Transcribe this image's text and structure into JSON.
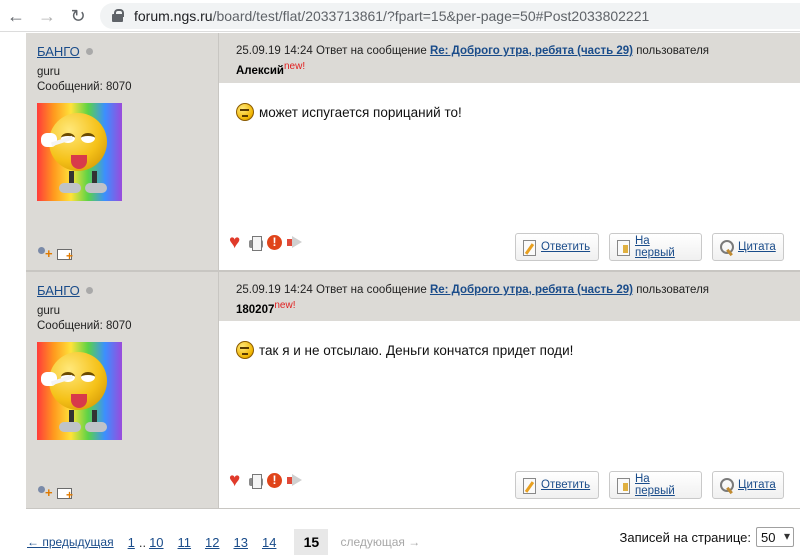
{
  "browser": {
    "url_domain": "forum.ngs.ru",
    "url_path": "/board/test/flat/2033713861/?fpart=15&per-page=50#Post2033802221"
  },
  "posts": [
    {
      "author": "БАНГО",
      "rank": "guru",
      "msgcount": "Сообщений: 8070",
      "header_datetime": "25.09.19 14:24",
      "header_reply_text": "Ответ на сообщение",
      "header_thread": "Re: Доброго утра, ребята (часть 29)",
      "header_user_word": "пользователя",
      "reply_to_user": "Алексий",
      "new_badge": "new!",
      "body": "может испугается порицаний то!",
      "btn_reply": "Ответить",
      "btn_first": "На первый",
      "btn_quote": "Цитата"
    },
    {
      "author": "БАНГО",
      "rank": "guru",
      "msgcount": "Сообщений: 8070",
      "header_datetime": "25.09.19 14:24",
      "header_reply_text": "Ответ на сообщение",
      "header_thread": "Re: Доброго утра, ребята (часть 29)",
      "header_user_word": "пользователя",
      "reply_to_user": "180207",
      "new_badge": "new!",
      "body": "так я и не отсылаю. Деньги кончатся придет поди!",
      "btn_reply": "Ответить",
      "btn_first": "На первый",
      "btn_quote": "Цитата"
    }
  ],
  "pager": {
    "prev": "← предыдущая",
    "pages": [
      "1",
      "10",
      "11",
      "12",
      "13",
      "14"
    ],
    "dots": "..",
    "current": "15",
    "next": "следующая →"
  },
  "perpage": {
    "label": "Записей на странице:",
    "value": "50"
  },
  "colors": {
    "link": "#1a4c8a",
    "panel": "#dcdad6",
    "new_badge": "#e02020"
  }
}
